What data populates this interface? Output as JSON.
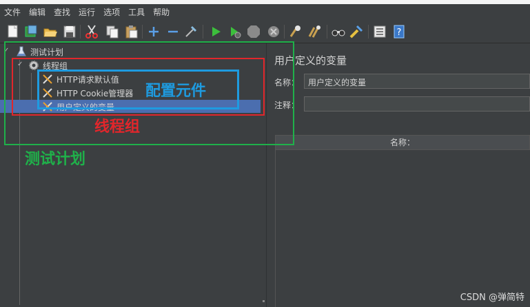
{
  "menubar": {
    "items": [
      {
        "label": "文件"
      },
      {
        "label": "编辑"
      },
      {
        "label": "查找"
      },
      {
        "label": "运行"
      },
      {
        "label": "选项"
      },
      {
        "label": "工具"
      },
      {
        "label": "帮助"
      }
    ]
  },
  "toolbar": {
    "icons": [
      "new-icon",
      "templates-icon",
      "open-icon",
      "save-icon",
      "cut-icon",
      "copy-icon",
      "paste-icon",
      "expand-icon",
      "collapse-icon",
      "toggle-icon",
      "start-icon",
      "start-no-pause-icon",
      "stop-icon",
      "shutdown-icon",
      "clear-icon",
      "clear-all-icon",
      "search-icon",
      "reset-search-icon",
      "function-helper-icon",
      "help-icon"
    ]
  },
  "tree": {
    "test_plan": "测试计划",
    "thread_group": "线程组",
    "items": [
      {
        "label": "HTTP请求默认值"
      },
      {
        "label": "HTTP Cookie管理器"
      },
      {
        "label": "用户定义的变量"
      }
    ]
  },
  "annotations": {
    "config_elements": "配置元件",
    "thread_group": "线程组",
    "test_plan": "测试计划",
    "colors": {
      "green": "#1fb14a",
      "red": "#e2262b",
      "blue": "#1e9be0"
    }
  },
  "panel": {
    "title": "用户定义的变量",
    "name_label": "名称：",
    "name_value": "用户定义的变量",
    "comment_label": "注释：",
    "comment_value": "",
    "table_header": "名称："
  },
  "watermark": "CSDN @弹简特"
}
